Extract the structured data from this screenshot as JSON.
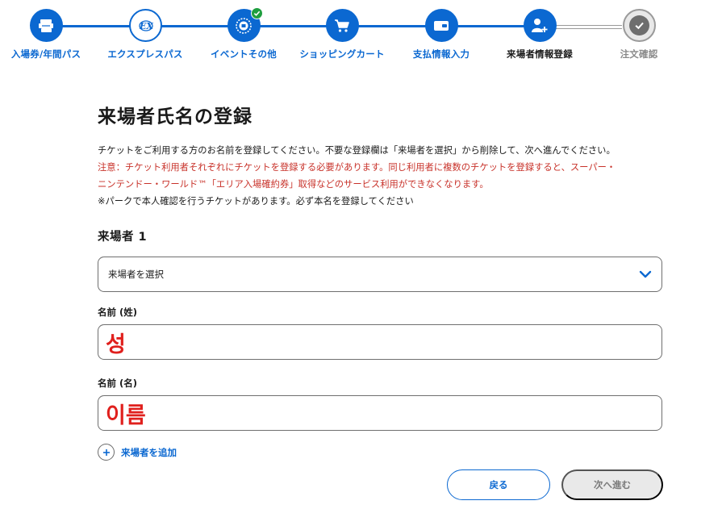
{
  "stepper": {
    "steps": [
      {
        "label": "入場券/年間パス",
        "icon": "ticket-icon",
        "state": "completed"
      },
      {
        "label": "エクスプレスパス",
        "icon": "express-pass-icon",
        "state": "completed-outline"
      },
      {
        "label": "イベントその他",
        "icon": "event-badge-icon",
        "state": "completed-checked"
      },
      {
        "label": "ショッピングカート",
        "icon": "shopping-cart-icon",
        "state": "completed"
      },
      {
        "label": "支払情報入力",
        "icon": "wallet-icon",
        "state": "completed"
      },
      {
        "label": "来場者情報登録",
        "icon": "add-person-icon",
        "state": "current"
      },
      {
        "label": "注文確認",
        "icon": "check-circle-icon",
        "state": "pending"
      }
    ]
  },
  "form": {
    "title": "来場者氏名の登録",
    "description": "チケットをご利用する方のお名前を登録してください。不要な登録欄は「来場者を選択」から削除して、次へ進んでください。",
    "warning_line1": "注意：チケット利用者それぞれにチケットを登録する必要があります。同じ利用者に複数のチケットを登録すると、スーパー・",
    "warning_line2": "ニンテンドー・ワールド™「エリア入場確約券」取得などのサービス利用ができなくなります。",
    "note": "※パークで本人確認を行うチケットがあります。必ず本名を登録してください",
    "visitor_heading": "来場者 1",
    "select_placeholder": "来場者を選択",
    "last_name_label": "名前 (姓)",
    "last_name_value": "성",
    "first_name_label": "名前 (名)",
    "first_name_value": "이름",
    "add_visitor_label": "来場者を追加"
  },
  "actions": {
    "back_label": "戻る",
    "next_label": "次へ進む"
  },
  "colors": {
    "primary": "#0b68d1",
    "warning": "#c8322a",
    "annotation": "#e0201d",
    "success": "#1e9e3f",
    "disabled": "#e9e9e9"
  }
}
